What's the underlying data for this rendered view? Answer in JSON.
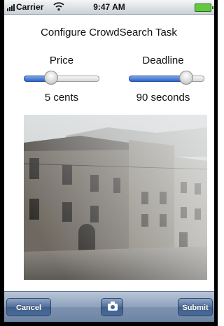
{
  "status_bar": {
    "carrier": "Carrier",
    "time": "9:47 AM",
    "icons": [
      "signal-bars-icon",
      "wifi-icon",
      "battery-icon"
    ]
  },
  "screen": {
    "title": "Configure CrowdSearch Task"
  },
  "price": {
    "label": "Price",
    "value_text": "5 cents",
    "slider_fraction": 0.33
  },
  "deadline": {
    "label": "Deadline",
    "value_text": "90 seconds",
    "slider_fraction": 0.82
  },
  "photo": {
    "subject": "old stone buildings on a foggy street"
  },
  "toolbar": {
    "cancel_label": "Cancel",
    "camera_icon": "camera-icon",
    "submit_label": "Submit"
  },
  "colors": {
    "slider_fill": "#2f63c9",
    "toolbar": "#7d92b0",
    "battery": "#63c83c"
  }
}
